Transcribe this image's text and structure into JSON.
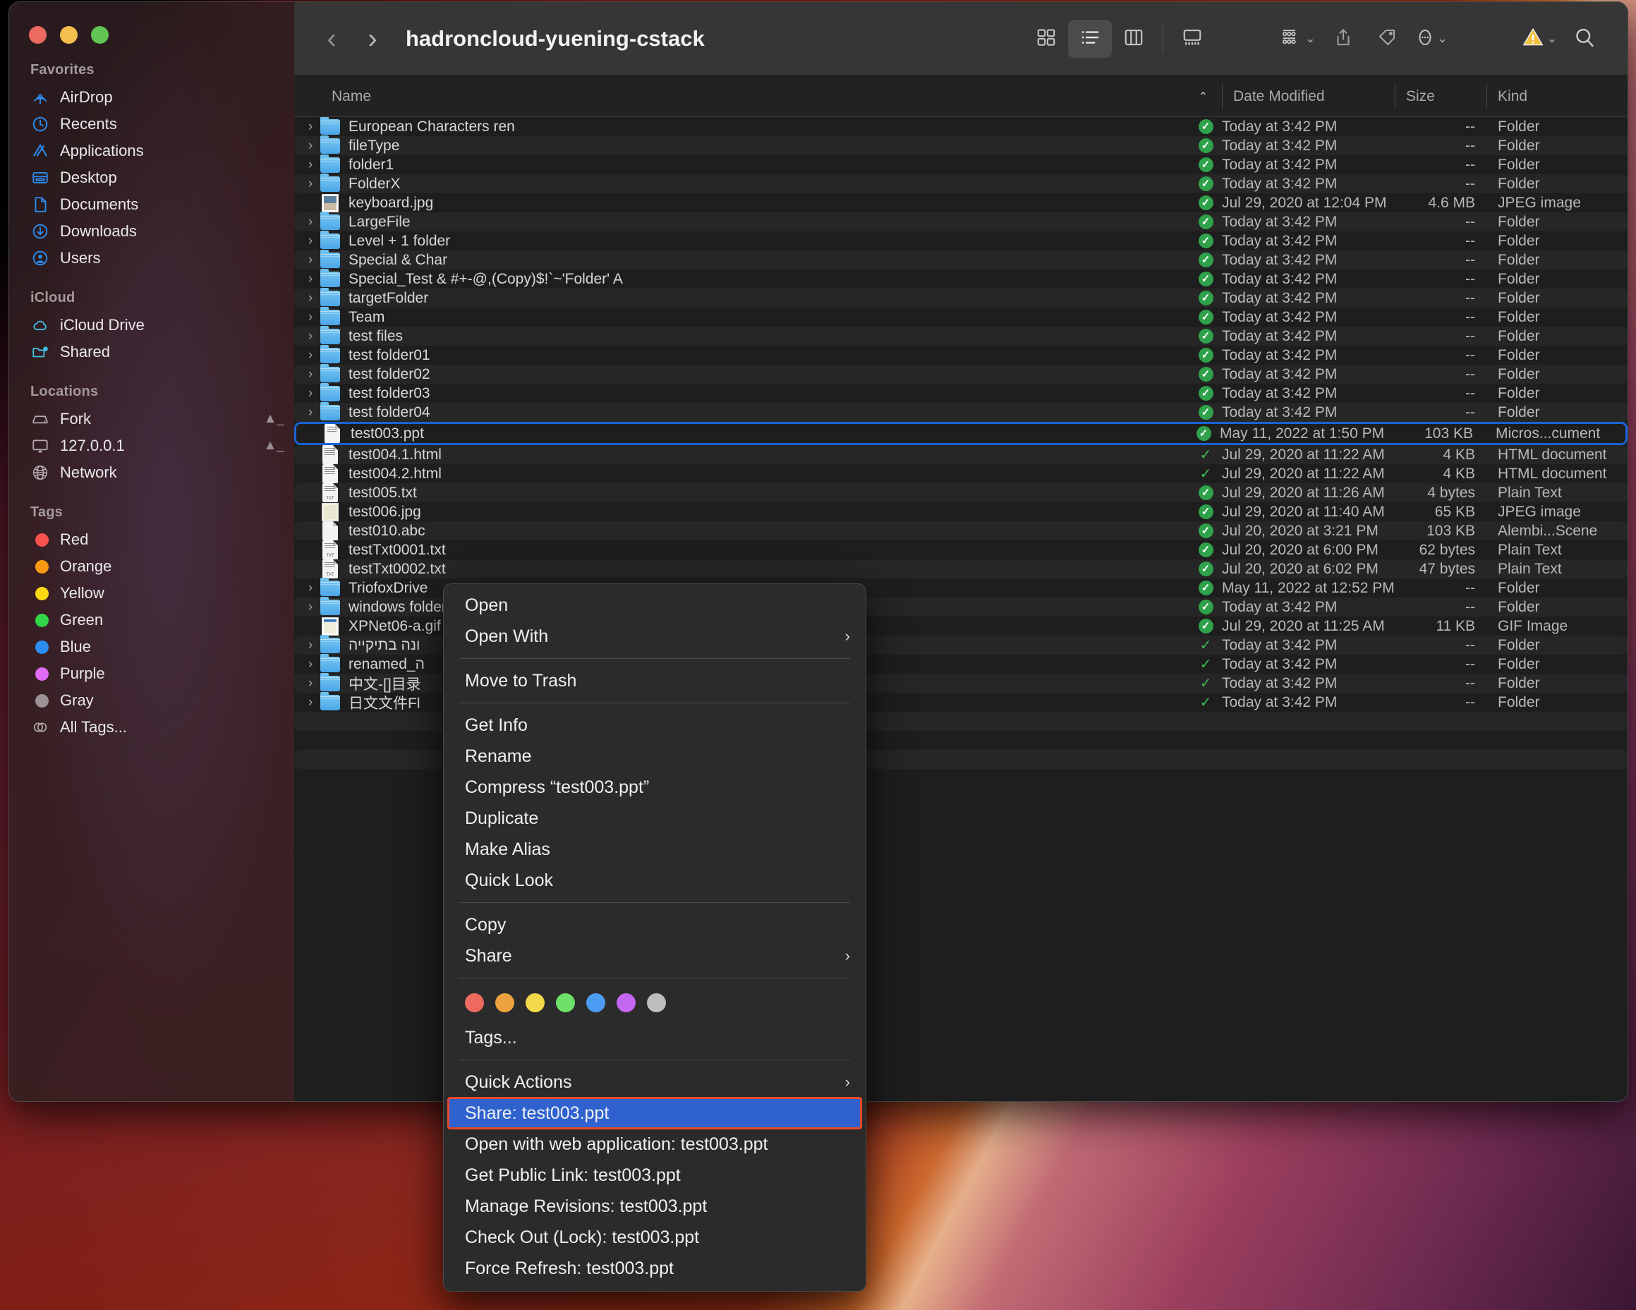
{
  "window": {
    "title": "hadroncloud-yuening-cstack",
    "back_label": "‹",
    "forward_label": "›"
  },
  "toolbar": {
    "icon_view": "icon-view-icon",
    "list_view": "list-view-icon",
    "column_view": "column-view-icon",
    "gallery_view": "gallery-view-icon",
    "group_by": "group-by-icon",
    "share": "share-icon",
    "tag": "tag-icon",
    "more": "more-actions-icon",
    "warning": "warning-triangle-icon",
    "search": "search-icon",
    "chevron": "⌄"
  },
  "columns": {
    "name": "Name",
    "sort_indicator": "⌃",
    "date_modified": "Date Modified",
    "size": "Size",
    "kind": "Kind"
  },
  "sidebar": {
    "sections": [
      {
        "title": "Favorites",
        "items": [
          {
            "label": "AirDrop",
            "icon": "airdrop-icon"
          },
          {
            "label": "Recents",
            "icon": "clock-icon"
          },
          {
            "label": "Applications",
            "icon": "applications-icon"
          },
          {
            "label": "Desktop",
            "icon": "desktop-icon"
          },
          {
            "label": "Documents",
            "icon": "document-icon"
          },
          {
            "label": "Downloads",
            "icon": "download-icon"
          },
          {
            "label": "Users",
            "icon": "user-icon"
          }
        ]
      },
      {
        "title": "iCloud",
        "items": [
          {
            "label": "iCloud Drive",
            "icon": "cloud-icon"
          },
          {
            "label": "Shared",
            "icon": "shared-folder-icon"
          }
        ]
      },
      {
        "title": "Locations",
        "items": [
          {
            "label": "Fork",
            "icon": "disk-icon",
            "eject": true
          },
          {
            "label": "127.0.0.1",
            "icon": "display-icon",
            "eject": true
          },
          {
            "label": "Network",
            "icon": "globe-icon"
          }
        ]
      },
      {
        "title": "Tags",
        "items": [
          {
            "label": "Red",
            "icon": "tag-dot-icon",
            "color": "#f8544e"
          },
          {
            "label": "Orange",
            "icon": "tag-dot-icon",
            "color": "#fa9a14"
          },
          {
            "label": "Yellow",
            "icon": "tag-dot-icon",
            "color": "#fcd913"
          },
          {
            "label": "Green",
            "icon": "tag-dot-icon",
            "color": "#31d446"
          },
          {
            "label": "Blue",
            "icon": "tag-dot-icon",
            "color": "#2d8ef2"
          },
          {
            "label": "Purple",
            "icon": "tag-dot-icon",
            "color": "#e06bf4"
          },
          {
            "label": "Gray",
            "icon": "tag-dot-icon",
            "color": "#9b9397"
          },
          {
            "label": "All Tags...",
            "icon": "all-tags-icon"
          }
        ]
      }
    ]
  },
  "files": [
    {
      "name": "European Characters ren",
      "icon": "folder",
      "disclosure": true,
      "status": "synced-filled",
      "date": "Today at 3:42 PM",
      "size": "--",
      "kind": "Folder"
    },
    {
      "name": "fileType",
      "icon": "folder",
      "disclosure": true,
      "status": "synced-filled",
      "date": "Today at 3:42 PM",
      "size": "--",
      "kind": "Folder"
    },
    {
      "name": "folder1",
      "icon": "folder",
      "disclosure": true,
      "status": "synced-filled",
      "date": "Today at 3:42 PM",
      "size": "--",
      "kind": "Folder"
    },
    {
      "name": "FolderX",
      "icon": "folder",
      "disclosure": true,
      "status": "synced-filled",
      "date": "Today at 3:42 PM",
      "size": "--",
      "kind": "Folder"
    },
    {
      "name": "keyboard.jpg",
      "icon": "photo",
      "disclosure": false,
      "status": "synced-filled",
      "date": "Jul 29, 2020 at 12:04 PM",
      "size": "4.6 MB",
      "kind": "JPEG image"
    },
    {
      "name": "LargeFile",
      "icon": "folder",
      "disclosure": true,
      "status": "synced-filled",
      "date": "Today at 3:42 PM",
      "size": "--",
      "kind": "Folder"
    },
    {
      "name": "Level + 1 folder",
      "icon": "folder",
      "disclosure": true,
      "status": "synced-filled",
      "date": "Today at 3:42 PM",
      "size": "--",
      "kind": "Folder"
    },
    {
      "name": "Special & Char",
      "icon": "folder",
      "disclosure": true,
      "status": "synced-filled",
      "date": "Today at 3:42 PM",
      "size": "--",
      "kind": "Folder"
    },
    {
      "name": "Special_Test & #+-@,(Copy)$!`~'Folder' A",
      "icon": "folder",
      "disclosure": true,
      "status": "synced-filled",
      "date": "Today at 3:42 PM",
      "size": "--",
      "kind": "Folder"
    },
    {
      "name": "targetFolder",
      "icon": "folder",
      "disclosure": true,
      "status": "synced-filled",
      "date": "Today at 3:42 PM",
      "size": "--",
      "kind": "Folder"
    },
    {
      "name": "Team",
      "icon": "folder",
      "disclosure": true,
      "status": "synced-filled",
      "date": "Today at 3:42 PM",
      "size": "--",
      "kind": "Folder"
    },
    {
      "name": "test files",
      "icon": "folder",
      "disclosure": true,
      "status": "synced-filled",
      "date": "Today at 3:42 PM",
      "size": "--",
      "kind": "Folder"
    },
    {
      "name": "test folder01",
      "icon": "folder",
      "disclosure": true,
      "status": "synced-filled",
      "date": "Today at 3:42 PM",
      "size": "--",
      "kind": "Folder"
    },
    {
      "name": "test folder02",
      "icon": "folder",
      "disclosure": true,
      "status": "synced-filled",
      "date": "Today at 3:42 PM",
      "size": "--",
      "kind": "Folder"
    },
    {
      "name": "test folder03",
      "icon": "folder",
      "disclosure": true,
      "status": "synced-filled",
      "date": "Today at 3:42 PM",
      "size": "--",
      "kind": "Folder"
    },
    {
      "name": "test folder04",
      "icon": "folder",
      "disclosure": true,
      "status": "synced-filled",
      "date": "Today at 3:42 PM",
      "size": "--",
      "kind": "Folder"
    },
    {
      "name": "test003.ppt",
      "icon": "ppt",
      "disclosure": false,
      "status": "synced-filled",
      "date": "May 11, 2022 at 1:50 PM",
      "size": "103 KB",
      "kind": "Micros...cument",
      "selected": true
    },
    {
      "name": "test004.1.html",
      "icon": "doc",
      "disclosure": false,
      "status": "check",
      "date": "Jul 29, 2020 at 11:22 AM",
      "size": "4 KB",
      "kind": "HTML document"
    },
    {
      "name": "test004.2.html",
      "icon": "doc",
      "disclosure": false,
      "status": "check",
      "date": "Jul 29, 2020 at 11:22 AM",
      "size": "4 KB",
      "kind": "HTML document"
    },
    {
      "name": "test005.txt",
      "icon": "txt",
      "disclosure": false,
      "status": "synced-filled",
      "date": "Jul 29, 2020 at 11:26 AM",
      "size": "4 bytes",
      "kind": "Plain Text"
    },
    {
      "name": "test006.jpg",
      "icon": "photo2",
      "disclosure": false,
      "status": "synced-filled",
      "date": "Jul 29, 2020 at 11:40 AM",
      "size": "65 KB",
      "kind": "JPEG image"
    },
    {
      "name": "test010.abc",
      "icon": "blank",
      "disclosure": false,
      "status": "synced-filled",
      "date": "Jul 20, 2020 at 3:21 PM",
      "size": "103 KB",
      "kind": "Alembi...Scene"
    },
    {
      "name": "testTxt0001.txt",
      "icon": "txt",
      "disclosure": false,
      "status": "synced-filled",
      "date": "Jul 20, 2020 at 6:00 PM",
      "size": "62 bytes",
      "kind": "Plain Text"
    },
    {
      "name": "testTxt0002.txt",
      "icon": "txt",
      "disclosure": false,
      "status": "synced-filled",
      "date": "Jul 20, 2020 at 6:02 PM",
      "size": "47 bytes",
      "kind": "Plain Text"
    },
    {
      "name": "TriofoxDrive",
      "icon": "folder",
      "disclosure": true,
      "status": "synced-filled",
      "date": "May 11, 2022 at 12:52 PM",
      "size": "--",
      "kind": "Folder"
    },
    {
      "name": "windows folder",
      "icon": "folder",
      "disclosure": true,
      "status": "synced-filled",
      "date": "Today at 3:42 PM",
      "size": "--",
      "kind": "Folder"
    },
    {
      "name": "XPNet06-a.gif",
      "icon": "win",
      "disclosure": false,
      "status": "synced-filled",
      "date": "Jul 29, 2020 at 11:25 AM",
      "size": "11 KB",
      "kind": "GIF Image"
    },
    {
      "name": "ונה בתיקייה",
      "icon": "folder",
      "disclosure": true,
      "status": "check",
      "date": "Today at 3:42 PM",
      "size": "--",
      "kind": "Folder"
    },
    {
      "name": "renamed_ה",
      "icon": "folder",
      "disclosure": true,
      "status": "check",
      "date": "Today at 3:42 PM",
      "size": "--",
      "kind": "Folder"
    },
    {
      "name": "中文-[]目录",
      "icon": "folder",
      "disclosure": true,
      "status": "check",
      "date": "Today at 3:42 PM",
      "size": "--",
      "kind": "Folder"
    },
    {
      "name": "日文文件Fl",
      "icon": "folder",
      "disclosure": true,
      "status": "check",
      "date": "Today at 3:42 PM",
      "size": "--",
      "kind": "Folder"
    }
  ],
  "context_menu": {
    "items": [
      {
        "label": "Open"
      },
      {
        "label": "Open With",
        "submenu": true
      },
      {
        "separator": true
      },
      {
        "label": "Move to Trash"
      },
      {
        "separator": true
      },
      {
        "label": "Get Info"
      },
      {
        "label": "Rename"
      },
      {
        "label": "Compress “test003.ppt”"
      },
      {
        "label": "Duplicate"
      },
      {
        "label": "Make Alias"
      },
      {
        "label": "Quick Look"
      },
      {
        "separator": true
      },
      {
        "label": "Copy"
      },
      {
        "label": "Share",
        "submenu": true
      },
      {
        "separator": true
      },
      {
        "swatches": [
          "#ef6a5e",
          "#eda23f",
          "#f3d849",
          "#6de067",
          "#4d9cf4",
          "#c367f0",
          "#bdbdbd"
        ]
      },
      {
        "label": "Tags..."
      },
      {
        "separator": true
      },
      {
        "label": "Quick Actions",
        "submenu": true
      },
      {
        "label": "Share: test003.ppt",
        "highlighted": true
      },
      {
        "label": "Open with web application: test003.ppt"
      },
      {
        "label": "Get Public Link: test003.ppt"
      },
      {
        "label": "Manage Revisions: test003.ppt"
      },
      {
        "label": "Check Out (Lock): test003.ppt"
      },
      {
        "label": "Force Refresh: test003.ppt"
      }
    ],
    "submenu_arrow": "›"
  },
  "colors": {
    "selection_blue": "#1763d6",
    "highlight_blue": "#2f62cf",
    "highlight_outline_red": "#e8482a",
    "sync_green": "#2fa14a"
  }
}
